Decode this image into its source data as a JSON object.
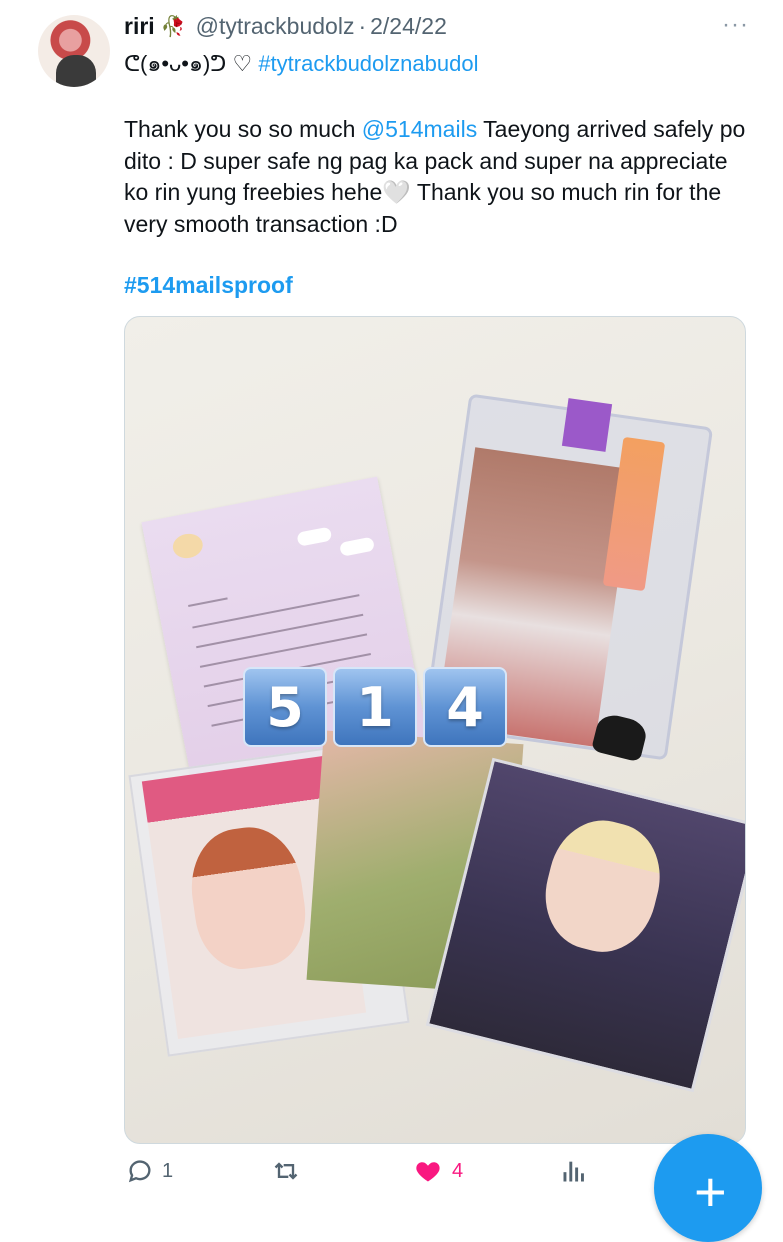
{
  "tweet": {
    "author_name": "riri",
    "author_handle": "@tytrackbudolz",
    "separator": "·",
    "date": "2/24/22",
    "more_icon": "···",
    "bio_emoticon": "ᕦ(๑•ᴗ•๑)ᕤ ♡",
    "bio_hashtag": "#tytrackbudolznabudol",
    "text_part1": "Thank you so so much ",
    "mention": "@514mails",
    "text_part2": " Taeyong arrived safely po dito : D super safe ng pag ka pack and super na appreciate ko rin yung freebies hehe🤍  Thank you so much rin for the very smooth transaction :D",
    "hashtag": "#514mailsproof",
    "badge_digits": [
      "5",
      "1",
      "4"
    ]
  },
  "actions": {
    "reply_count": "1",
    "retweet_count": "",
    "like_count": "4"
  },
  "colors": {
    "link": "#1d9bf0",
    "like": "#f91880",
    "secondary_text": "#536471"
  },
  "icons": [
    "reply-icon",
    "retweet-icon",
    "like-icon",
    "analytics-icon",
    "compose-icon",
    "rose-icon",
    "more-icon"
  ]
}
